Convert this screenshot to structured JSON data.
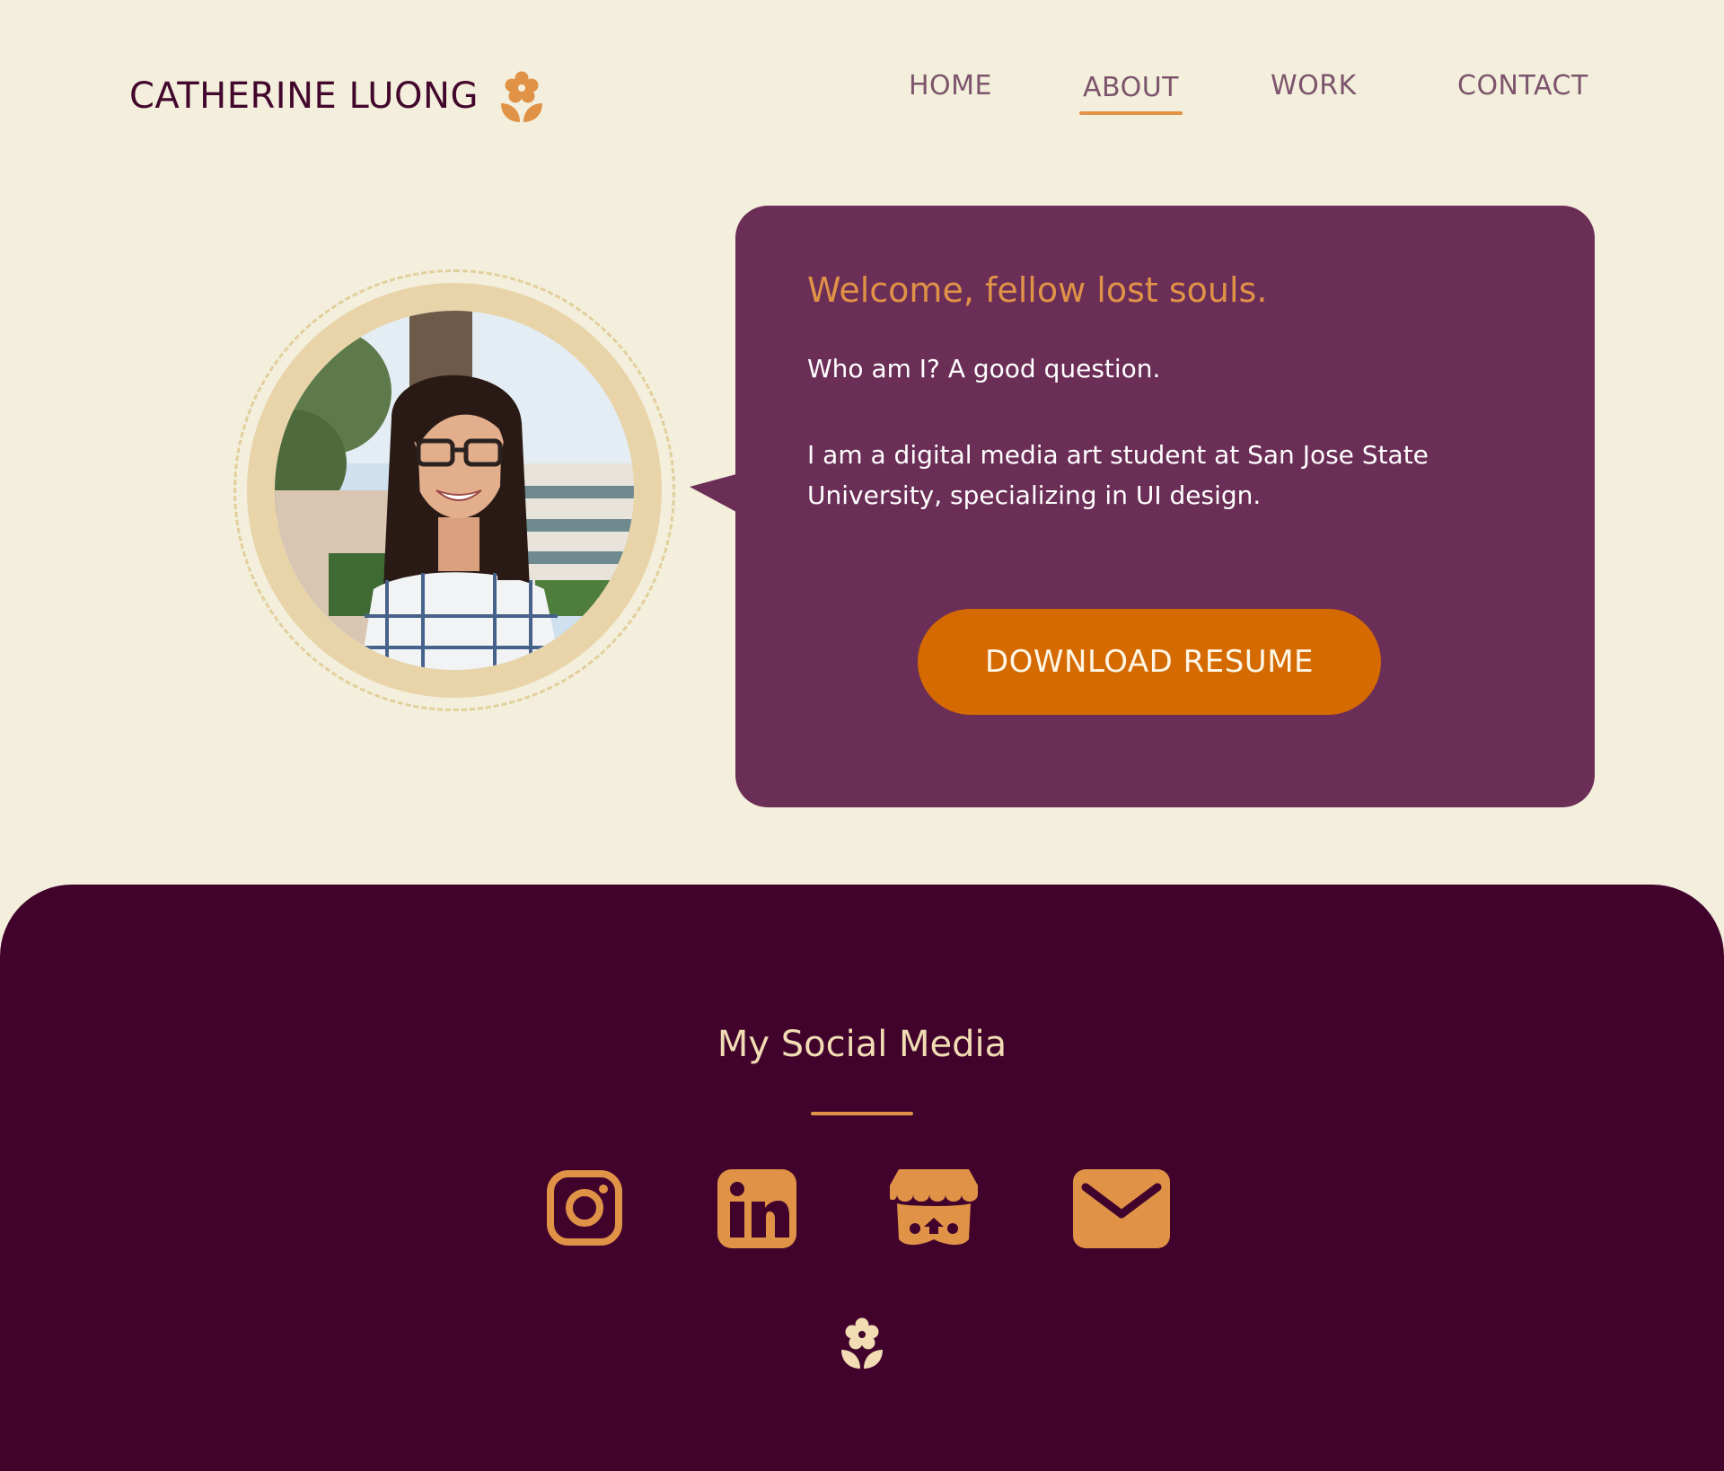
{
  "colors": {
    "background": "#f3efdc",
    "brand_text": "#43072d",
    "nav_text": "#7c556c",
    "accent": "#e09247",
    "bubble": "#6b2e56",
    "button": "#d46a00",
    "footer": "#41032c",
    "footer_title": "#f1dcb3"
  },
  "header": {
    "brand_name": "CATHERINE LUONG",
    "brand_icon": "flower-icon",
    "nav": [
      {
        "label": "HOME",
        "active": false
      },
      {
        "label": "ABOUT",
        "active": true
      },
      {
        "label": "WORK",
        "active": false
      },
      {
        "label": "CONTACT",
        "active": false
      }
    ]
  },
  "hero": {
    "portrait_alt": "portrait photo",
    "title": "Welcome, fellow lost souls.",
    "line1": "Who am I? A good question.",
    "line2": "I am a digital media art student at San Jose State University, specializing in UI design.",
    "button_label": "DOWNLOAD RESUME"
  },
  "footer": {
    "title": "My Social Media",
    "social": [
      {
        "name": "instagram-icon"
      },
      {
        "name": "linkedin-icon"
      },
      {
        "name": "itchio-icon"
      },
      {
        "name": "email-icon"
      }
    ],
    "bottom_icon": "flower-icon"
  }
}
